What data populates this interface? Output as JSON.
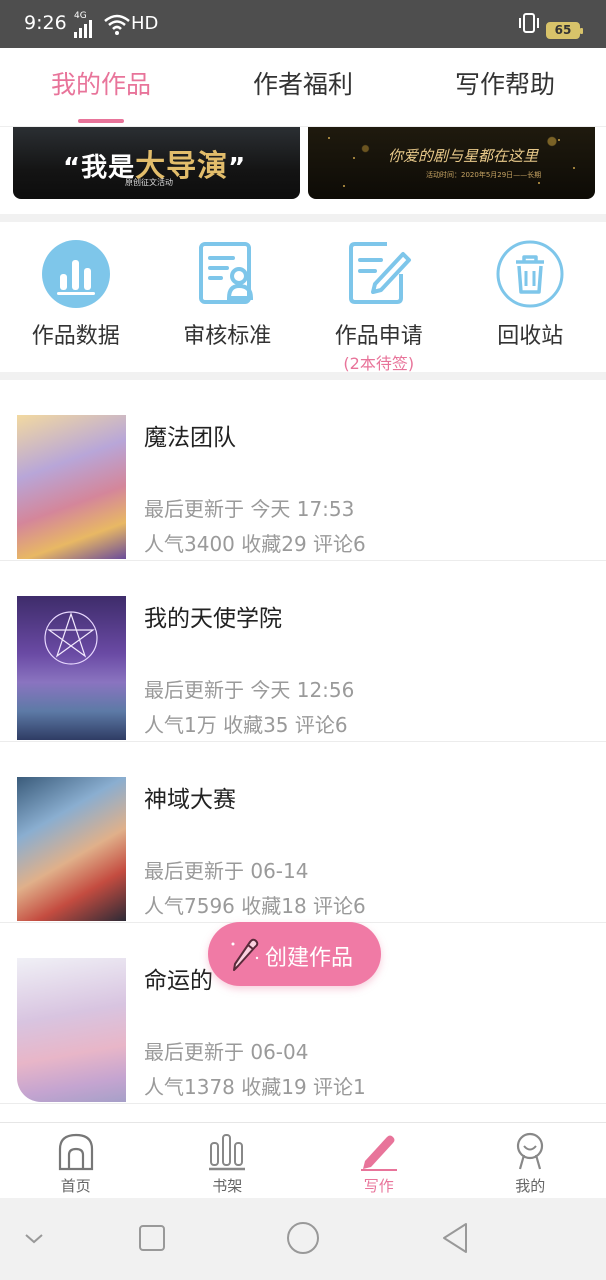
{
  "status_bar": {
    "time": "9:26",
    "network": "4G",
    "hd": "HD",
    "battery": "65"
  },
  "top_tabs": [
    {
      "label": "我的作品",
      "active": true
    },
    {
      "label": "作者福利",
      "active": false
    },
    {
      "label": "写作帮助",
      "active": false
    }
  ],
  "banners": {
    "left": {
      "title_quote_open": "“我是",
      "title_big": "大导演",
      "title_quote_close": "”",
      "subtitle": "原创征文活动"
    },
    "right": {
      "title": "你爱的剧与星都在这里",
      "subtitle": "活动时间：2020年5月29日——长期"
    }
  },
  "actions": [
    {
      "label": "作品数据",
      "icon": "chart-icon"
    },
    {
      "label": "审核标准",
      "icon": "review-icon"
    },
    {
      "label": "作品申请",
      "icon": "edit-doc-icon",
      "note": "(2本待签)"
    },
    {
      "label": "回收站",
      "icon": "trash-icon"
    }
  ],
  "works": [
    {
      "title": "魔法团队",
      "updated": "最后更新于 今天 17:53",
      "stats": "人气3400 收藏29 评论6"
    },
    {
      "title": "我的天使学院",
      "updated": "最后更新于 今天 12:56",
      "stats": "人气1万 收藏35 评论6"
    },
    {
      "title": "神域大赛",
      "updated": "最后更新于 06-14",
      "stats": "人气7596 收藏18 评论6"
    },
    {
      "title": "命运的",
      "updated": "最后更新于 06-04",
      "stats": "人气1378 收藏19 评论1"
    }
  ],
  "fab": {
    "label": "创建作品"
  },
  "bottom_nav": [
    {
      "label": "首页",
      "icon": "home-icon",
      "active": false
    },
    {
      "label": "书架",
      "icon": "bookshelf-icon",
      "active": false
    },
    {
      "label": "写作",
      "icon": "pen-icon",
      "active": true
    },
    {
      "label": "我的",
      "icon": "profile-icon",
      "active": false
    }
  ],
  "colors": {
    "accent": "#e8749a",
    "fab": "#f07aa5",
    "icon_blue": "#7ec6ea"
  }
}
